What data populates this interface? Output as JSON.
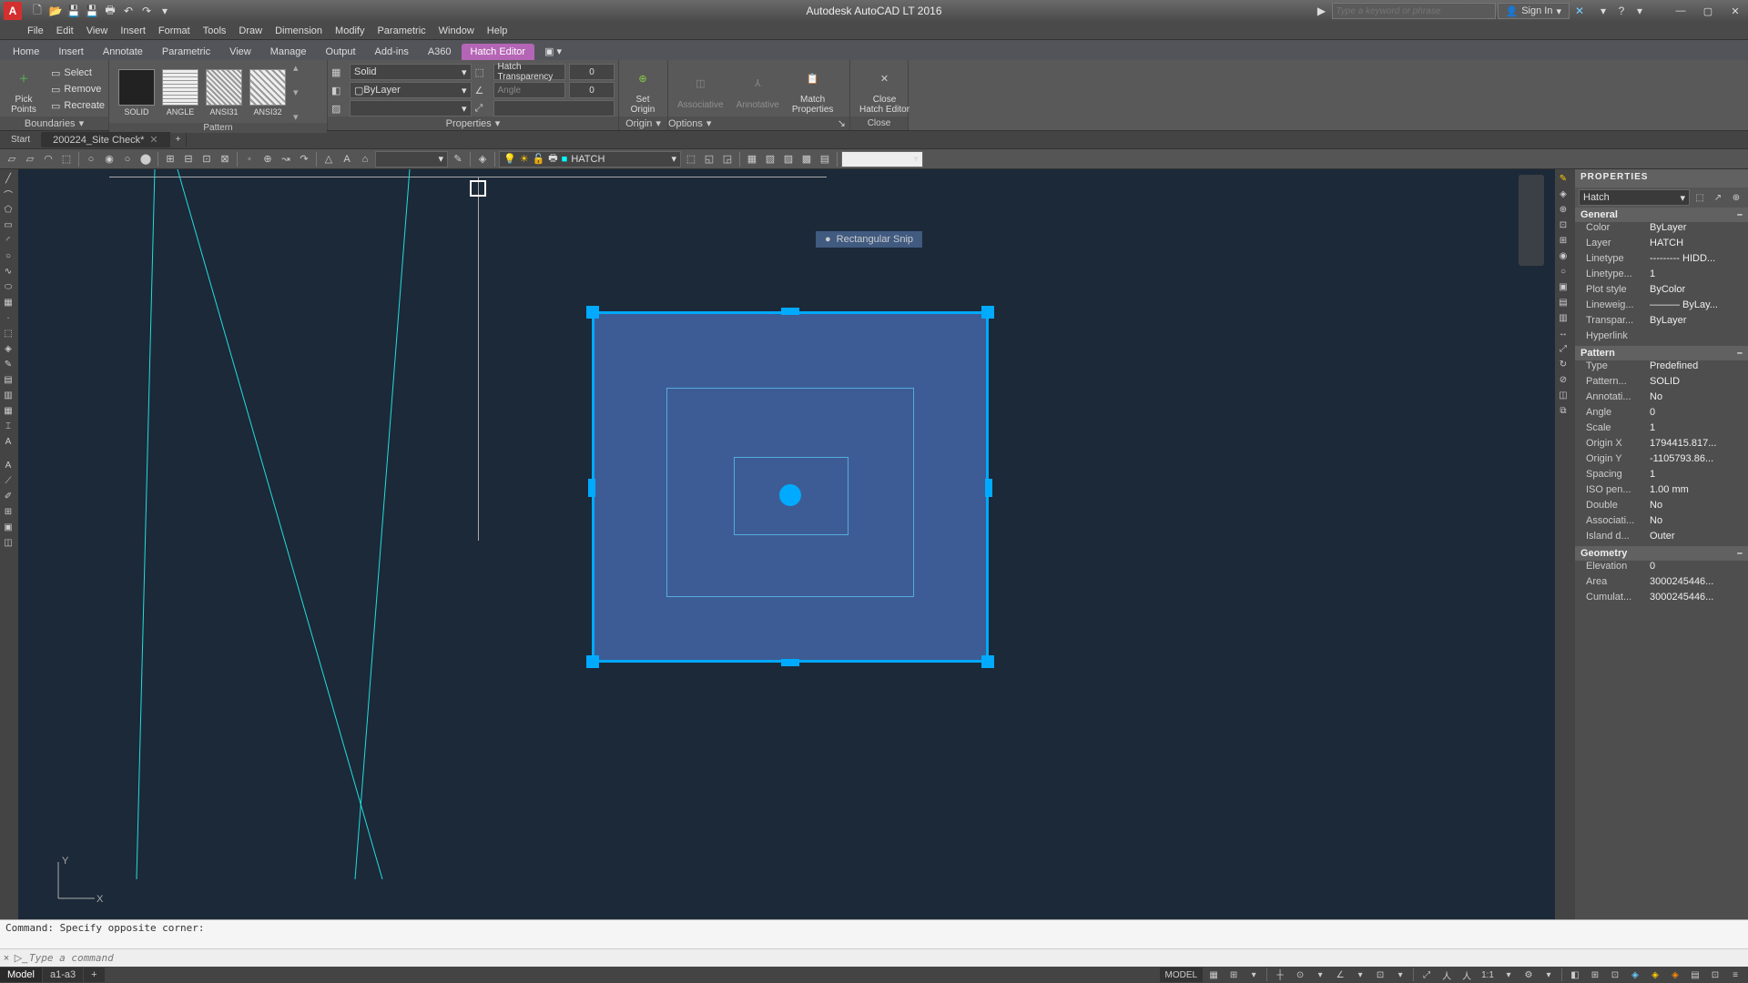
{
  "app": {
    "title": "Autodesk AutoCAD LT 2016",
    "icon_letter": "A"
  },
  "menus": [
    "File",
    "Edit",
    "View",
    "Insert",
    "Format",
    "Tools",
    "Draw",
    "Dimension",
    "Modify",
    "Parametric",
    "Window",
    "Help"
  ],
  "search_placeholder": "Type a keyword or phrase",
  "signin": "Sign In",
  "ribbon_tabs": [
    "Home",
    "Insert",
    "Annotate",
    "Parametric",
    "View",
    "Manage",
    "Output",
    "Add-ins",
    "A360",
    "Hatch Editor"
  ],
  "active_ribbon": "Hatch Editor",
  "panels": {
    "boundaries": {
      "title": "Boundaries",
      "pick": "Pick Points",
      "select": "Select",
      "remove": "Remove",
      "recreate": "Recreate"
    },
    "pattern": {
      "title": "Pattern",
      "items": [
        "SOLID",
        "ANGLE",
        "ANSI31",
        "ANSI32"
      ]
    },
    "properties": {
      "title": "Properties",
      "type": "Solid",
      "color": "ByLayer",
      "angle_label": "Angle",
      "trans_label": "Hatch Transparency",
      "trans_val": "0",
      "angle_val": "0"
    },
    "origin": {
      "title": "Origin",
      "set": "Set\nOrigin"
    },
    "options": {
      "title": "Options",
      "assoc": "Associative",
      "annot": "Annotative",
      "match": "Match\nProperties"
    },
    "close": {
      "title": "Close",
      "close": "Close\nHatch Editor"
    }
  },
  "filetabs": {
    "start": "Start",
    "doc": "200224_Site Check*"
  },
  "layer_current": "HATCH",
  "snip": "Rectangular Snip",
  "properties_palette": {
    "title": "PROPERTIES",
    "selection": "Hatch",
    "sections": [
      {
        "name": "General",
        "rows": [
          [
            "Color",
            "ByLayer"
          ],
          [
            "Layer",
            "HATCH"
          ],
          [
            "Linetype",
            "--------- HIDD..."
          ],
          [
            "Linetype...",
            "1"
          ],
          [
            "Plot style",
            "ByColor"
          ],
          [
            "Lineweig...",
            "——— ByLay..."
          ],
          [
            "Transpar...",
            "ByLayer"
          ],
          [
            "Hyperlink",
            ""
          ]
        ]
      },
      {
        "name": "Pattern",
        "rows": [
          [
            "Type",
            "Predefined"
          ],
          [
            "Pattern...",
            "SOLID"
          ],
          [
            "Annotati...",
            "No"
          ],
          [
            "Angle",
            "0"
          ],
          [
            "Scale",
            "1"
          ],
          [
            "Origin X",
            "1794415.817..."
          ],
          [
            "Origin Y",
            "-1105793.86..."
          ],
          [
            "Spacing",
            "1"
          ],
          [
            "ISO pen...",
            "1.00 mm"
          ],
          [
            "Double",
            "No"
          ],
          [
            "Associati...",
            "No"
          ],
          [
            "Island d...",
            "Outer"
          ]
        ]
      },
      {
        "name": "Geometry",
        "rows": [
          [
            "Elevation",
            "0"
          ],
          [
            "Area",
            "3000245446..."
          ],
          [
            "Cumulat...",
            "3000245446..."
          ]
        ]
      }
    ]
  },
  "cmd_log": "Command: Specify opposite corner:",
  "cmd_placeholder": "Type a command",
  "status": {
    "model": "Model",
    "layout": "a1-a3",
    "model_btn": "MODEL",
    "scale": "1:1"
  }
}
